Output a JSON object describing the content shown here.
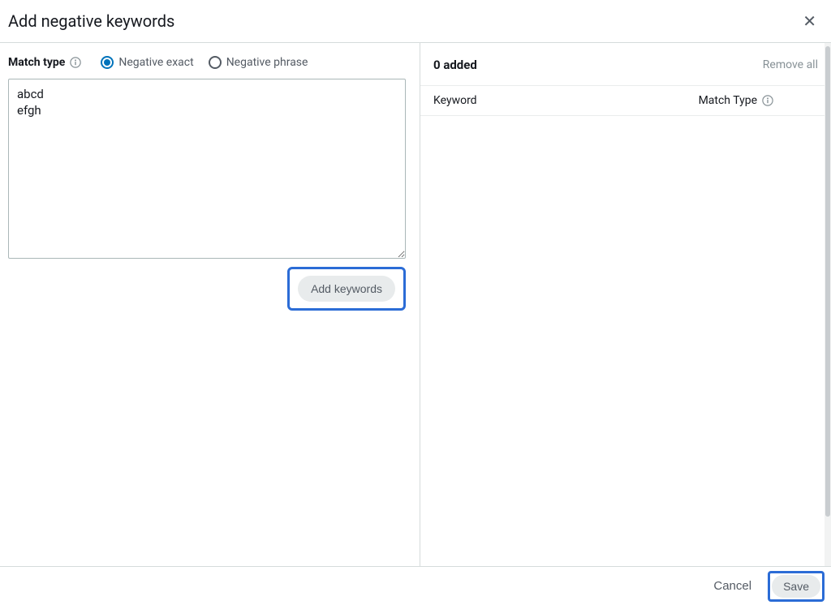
{
  "modal": {
    "title": "Add negative keywords"
  },
  "matchType": {
    "label": "Match type",
    "options": [
      {
        "label": "Negative exact",
        "checked": true
      },
      {
        "label": "Negative phrase",
        "checked": false
      }
    ]
  },
  "keywordInput": {
    "value": "abcd\nefgh"
  },
  "addKeywords": {
    "label": "Add keywords"
  },
  "rightPanel": {
    "addedCount": "0 added",
    "removeAll": "Remove all",
    "columns": {
      "keyword": "Keyword",
      "matchType": "Match Type"
    }
  },
  "footer": {
    "cancel": "Cancel",
    "save": "Save"
  }
}
